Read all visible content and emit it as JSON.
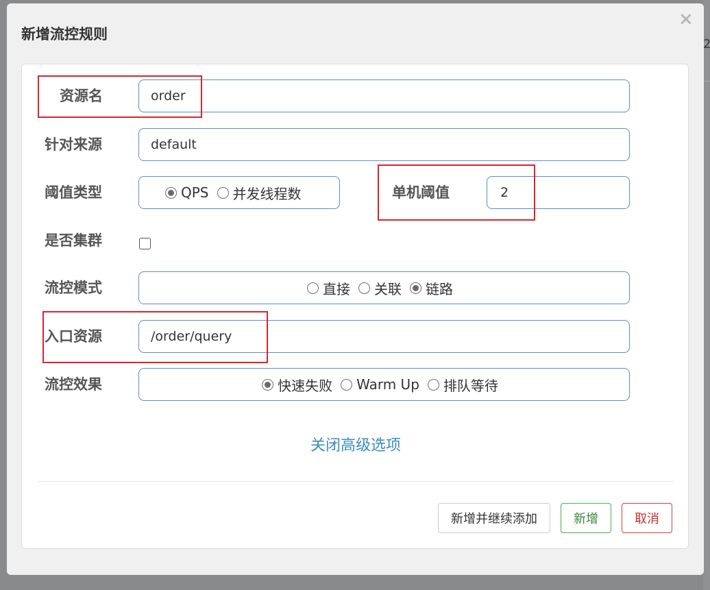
{
  "background": {
    "edge_text": "2"
  },
  "modal": {
    "title": "新增流控规则"
  },
  "form": {
    "resource": {
      "label": "资源名",
      "value": "order"
    },
    "limit_app": {
      "label": "针对来源",
      "value": "default"
    },
    "grade": {
      "label": "阈值类型",
      "options": [
        "QPS",
        "并发线程数"
      ],
      "selected": "QPS"
    },
    "count": {
      "label": "单机阈值",
      "value": "2"
    },
    "cluster": {
      "label": "是否集群",
      "checked": false
    },
    "strategy": {
      "label": "流控模式",
      "options": [
        "直接",
        "关联",
        "链路"
      ],
      "selected": "链路"
    },
    "ref_resource": {
      "label": "入口资源",
      "value": "/order/query"
    },
    "control_behavior": {
      "label": "流控效果",
      "options": [
        "快速失败",
        "Warm Up",
        "排队等待"
      ],
      "selected": "快速失败"
    }
  },
  "advanced_toggle": "关闭高级选项",
  "buttons": {
    "add_continue": "新增并继续添加",
    "add": "新增",
    "cancel": "取消"
  },
  "colors": {
    "highlight": "#d9232e",
    "link": "#3c8dbc",
    "field_border": "#5b8ec7",
    "success": "#398439",
    "danger": "#c9302c"
  }
}
